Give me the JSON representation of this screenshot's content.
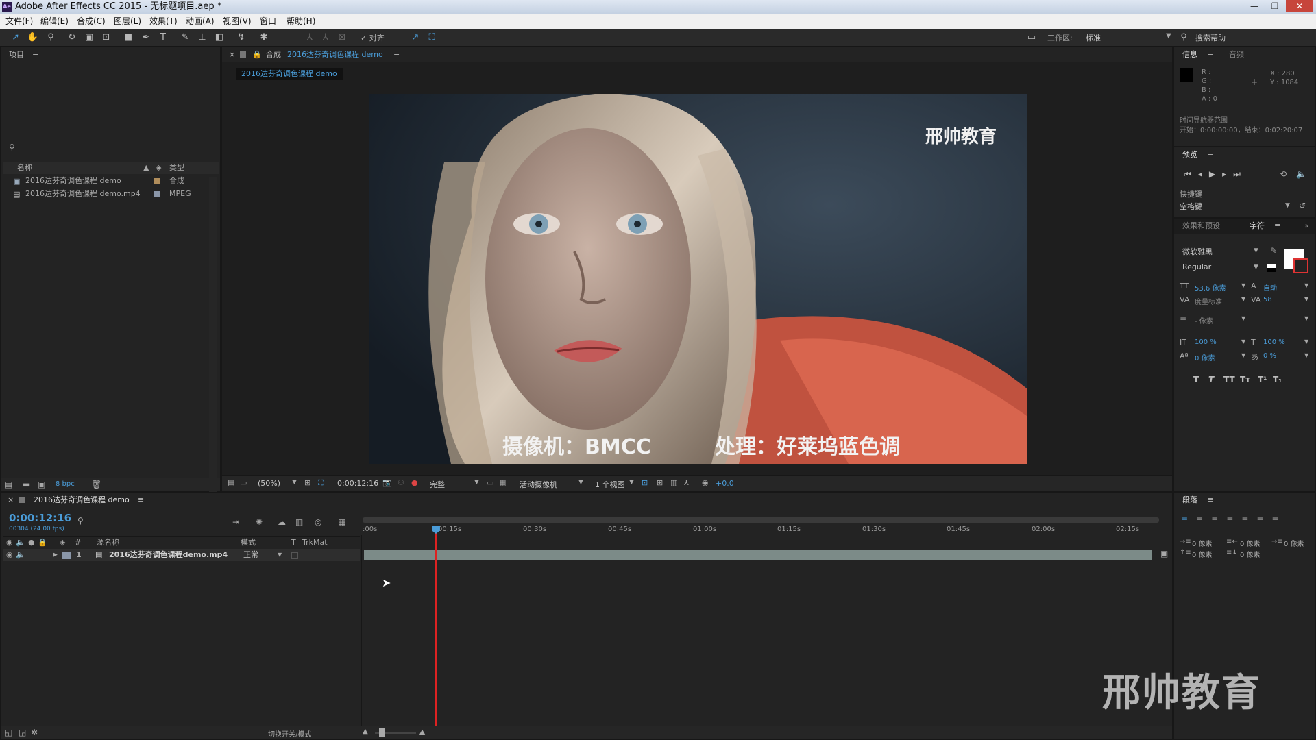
{
  "app": {
    "title": "Adobe After Effects CC 2015 - 无标题项目.aep *",
    "logo": "Ae"
  },
  "window_controls": [
    "—",
    "❐",
    "✕"
  ],
  "menu": [
    "文件(F)",
    "编辑(E)",
    "合成(C)",
    "图层(L)",
    "效果(T)",
    "动画(A)",
    "视图(V)",
    "窗口",
    "帮助(H)"
  ],
  "toolbar": {
    "snap_label": "✓ 对齐",
    "workspace_label": "工作区:",
    "workspace_value": "标准",
    "search_label": "搜索帮助"
  },
  "project": {
    "tab": "项目",
    "search_icon": "⚲",
    "col_name": "名称",
    "col_type": "类型",
    "items": [
      {
        "name": "2016达芬奇调色课程 demo",
        "type": "合成",
        "icon": "composition-icon",
        "color": "#b08d5b"
      },
      {
        "name": "2016达芬奇调色课程 demo.mp4",
        "type": "MPEG",
        "icon": "footage-icon",
        "color": "#8a96a8"
      }
    ],
    "bpc": "8 bpc"
  },
  "composition": {
    "tab_prefix": "合成",
    "tab_name": "2016达芬奇调色课程 demo",
    "breadcrumb": "2016达芬奇调色课程 demo",
    "watermark": "邢帅教育",
    "subtitle_left": "摄像机：BMCC",
    "subtitle_right": "处理：好莱坞蓝色调",
    "zoom": "(50%)",
    "timecode": "0:00:12:16",
    "resolution": "完整",
    "camera": "活动摄像机",
    "views": "1 个视图",
    "exposure": "+0.0"
  },
  "info": {
    "tab": "信息",
    "tab2": "音频",
    "r": "R :",
    "g": "G :",
    "b": "B :",
    "a": "A : 0",
    "x": "X : 280",
    "y": "Y : 1084",
    "nav_title": "时间导航器范围",
    "nav_range": "开始：0:00:00:00，结束：0:02:20:07"
  },
  "preview": {
    "tab": "预览",
    "shortcut_label": "快捷键",
    "shortcut_value": "空格键"
  },
  "character": {
    "tab1": "效果和预设",
    "tab2": "字符",
    "font": "微软雅黑",
    "style": "Regular",
    "size": "53.6 像素",
    "leading": "自动",
    "kerning": "度量标准",
    "tracking": "58",
    "stroke": "- 像素",
    "vscale": "100 %",
    "hscale": "100 %",
    "baseline": "0 像素",
    "tsume": "0 %",
    "styles": [
      "T",
      "T",
      "TT",
      "Tт",
      "T¹",
      "T₁"
    ]
  },
  "paragraph": {
    "tab": "段落",
    "indent_values": [
      "0 像素",
      "0 像素",
      "0 像素",
      "0 像素",
      "0 像素"
    ]
  },
  "timeline": {
    "tab": "2016达芬奇调色课程 demo",
    "timecode": "0:00:12:16",
    "frames": "00304 (24.00 fps)",
    "col_num": "#",
    "col_source": "源名称",
    "col_mode": "模式",
    "col_t": "T",
    "col_trkmat": "TrkMat",
    "layer_num": "1",
    "layer_name": "2016达芬奇调色课程demo.mp4",
    "layer_mode": "正常",
    "ticks": [
      ":00s",
      "00:15s",
      "00:30s",
      "00:45s",
      "01:00s",
      "01:15s",
      "01:30s",
      "01:45s",
      "02:00s",
      "02:15s"
    ],
    "toggle_label": "切换开关/模式",
    "playhead_fraction": 0.0904
  },
  "desktop_watermark": "邢帅教育"
}
